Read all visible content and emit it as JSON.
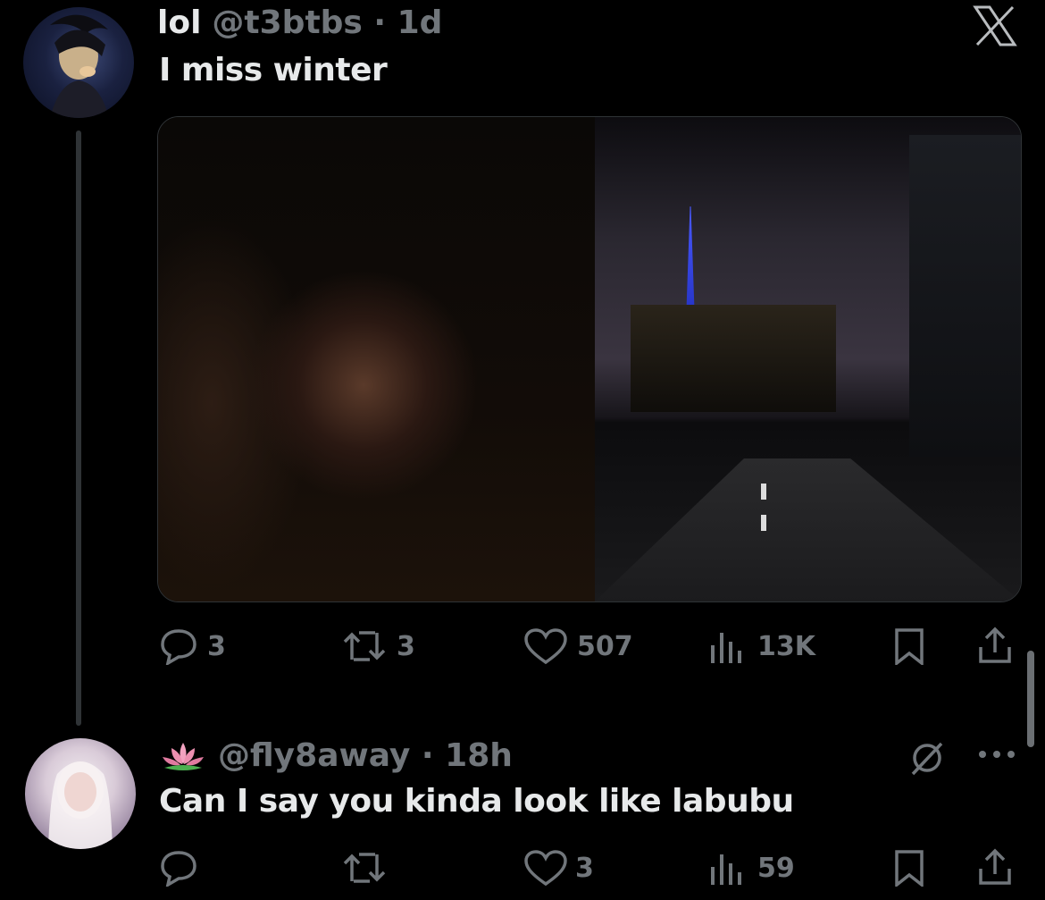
{
  "tweet": {
    "display_name": "lol",
    "handle_time": "@t3btbs · 1d",
    "text": "I miss winter",
    "replies": "3",
    "retweets": "3",
    "likes": "507",
    "views": "13K"
  },
  "reply": {
    "handle_time": "@fly8away · 18h",
    "text": "Can I say you kinda look like labubu",
    "replies": "",
    "retweets": "",
    "likes": "3",
    "views": "59"
  },
  "icons": {
    "close": "close-icon",
    "reply": "reply-icon",
    "retweet": "retweet-icon",
    "like": "heart-icon",
    "views": "views-icon",
    "bookmark": "bookmark-icon",
    "share": "share-icon",
    "grok": "grok-icon",
    "more": "more-icon",
    "lotus": "lotus-icon"
  },
  "colors": {
    "background": "#000000",
    "text_primary": "#e7e9ea",
    "text_secondary": "#71767b"
  }
}
